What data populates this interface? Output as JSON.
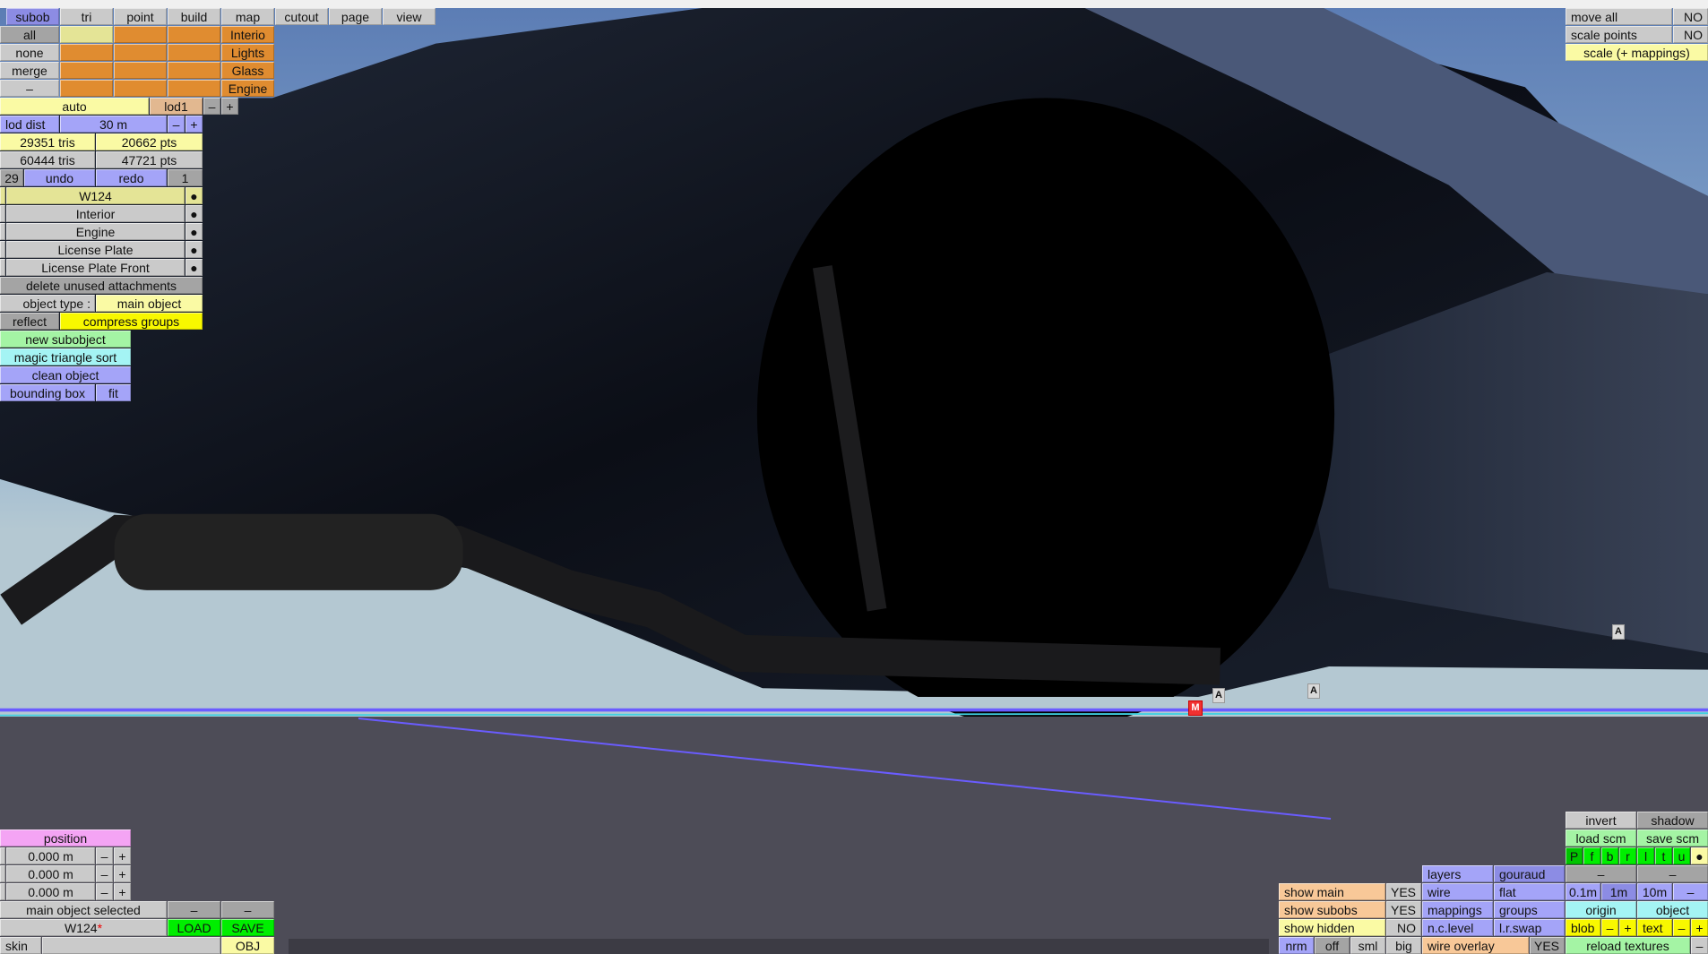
{
  "tabs": [
    "subob",
    "tri",
    "point",
    "build",
    "map",
    "cutout",
    "page",
    "view"
  ],
  "selection": {
    "all": "all",
    "none": "none",
    "merge": "merge",
    "dash": "–"
  },
  "groups": [
    "Interio",
    "Lights",
    "Glass",
    "Engine"
  ],
  "lod": {
    "auto": "auto",
    "level": "lod1",
    "minus": "–",
    "plus": "+",
    "dist_label": "lod dist",
    "dist": "30 m"
  },
  "stats": {
    "tris1": "29351 tris",
    "pts1": "20662 pts",
    "tris2": "60444 tris",
    "pts2": "47721 pts"
  },
  "history": {
    "count": "29",
    "undo": "undo",
    "redo": "redo",
    "step": "1"
  },
  "subobjects": [
    {
      "name": "W124"
    },
    {
      "name": "Interior"
    },
    {
      "name": "Engine"
    },
    {
      "name": "License Plate"
    },
    {
      "name": "License Plate Front"
    }
  ],
  "dot": "●",
  "actions": {
    "delete_unused": "delete unused attachments",
    "object_type_label": "object type :",
    "object_type": "main object",
    "reflect": "reflect",
    "compress": "compress groups",
    "new_subobject": "new subobject",
    "magic_sort": "magic triangle sort",
    "clean": "clean object",
    "bounding_box": "bounding box",
    "fit": "fit"
  },
  "position": {
    "label": "position",
    "values": [
      "0.000 m",
      "0.000 m",
      "0.000 m"
    ],
    "minus": "–",
    "plus": "+"
  },
  "file": {
    "status": "main object selected",
    "dash": "–",
    "name": "W124",
    "modified": "*",
    "load": "LOAD",
    "save": "SAVE",
    "skin": "skin",
    "obj": "OBJ"
  },
  "transform": {
    "move_all": "move all",
    "move_all_val": "NO",
    "scale_points": "scale points",
    "scale_points_val": "NO",
    "scale_mappings": "scale (+ mappings)"
  },
  "view": {
    "invert": "invert",
    "shadow": "shadow",
    "load_scm": "load scm",
    "save_scm": "save scm",
    "views": [
      "P",
      "f",
      "b",
      "r",
      "l",
      "t",
      "u"
    ],
    "dash": "–",
    "grid": [
      "0.1m",
      "1m",
      "10m"
    ],
    "origin": "origin",
    "object": "object",
    "blob": "blob",
    "text": "text",
    "minus": "–",
    "plus": "+",
    "reload": "reload textures"
  },
  "display": {
    "show_main": "show main",
    "show_main_val": "YES",
    "show_subobs": "show subobs",
    "show_subobs_val": "YES",
    "show_hidden": "show hidden",
    "show_hidden_val": "NO",
    "sizes": [
      "nrm",
      "off",
      "sml",
      "big"
    ],
    "layers": "layers",
    "gouraud": "gouraud",
    "wire": "wire",
    "flat": "flat",
    "mappings": "mappings",
    "groups": "groups",
    "nc_level": "n.c.level",
    "lr_swap": "l.r.swap",
    "wire_overlay": "wire overlay",
    "wire_overlay_val": "YES"
  },
  "markers": {
    "a": "A",
    "m": "M"
  },
  "colors": {
    "sky_top": "#5b7cb4",
    "sky_horizon": "#b4c8d2",
    "ground": "#4d4c57",
    "selection_line": "#6a5cff"
  }
}
